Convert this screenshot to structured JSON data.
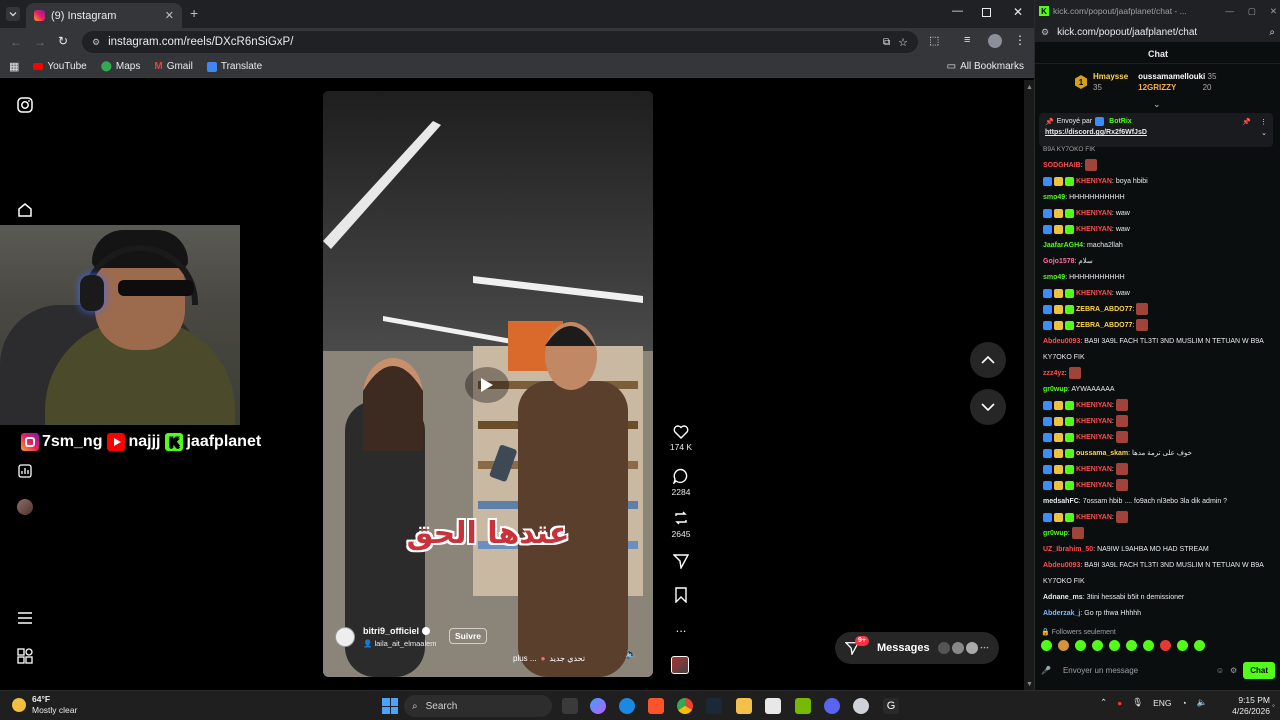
{
  "left_browser": {
    "tab_title": "(9) Instagram",
    "url": "instagram.com/reels/DXcR6nSiGxP/",
    "bookmarks": [
      "YouTube",
      "Maps",
      "Gmail",
      "Translate"
    ],
    "all_bookmarks": "All Bookmarks"
  },
  "instagram": {
    "notification_badge": "9+",
    "overlay_social": [
      "7sm_ng",
      "najjj",
      "jaafplanet"
    ],
    "reel": {
      "caption": "عندها الحق",
      "author": "bitri9_officiel",
      "follow_label": "Suivre",
      "collab": "laila_ait_elmaalem",
      "description": "تحدي جديد",
      "more": "plus ...",
      "likes": "174 K",
      "comments": "2284",
      "reposts": "2645",
      "more_icon": "..."
    },
    "messages_label": "Messages",
    "messages_badge": "9+"
  },
  "right_browser": {
    "title": "kick.com/popout/jaafplanet/chat - ...",
    "url": "kick.com/popout/jaafplanet/chat",
    "chat_header": "Chat",
    "top_gifters": [
      {
        "rank": "1",
        "name": "Hmaysse",
        "count": "35"
      },
      {
        "rank": "",
        "name": "oussamamellouki",
        "count": "35"
      },
      {
        "rank": "",
        "name": "12GRIZZY",
        "count": "20"
      }
    ],
    "pinned": {
      "by_label": "Envoyé par",
      "by_user": "BotRix",
      "link": "https://discord.gg/Rx2f6WfJsD",
      "partial_line": "B9A KY7OKO FIK"
    },
    "messages": [
      {
        "user": "SODGHAIB",
        "color": "#ff4d4d",
        "text": ""
      },
      {
        "user": "KHENIYAN",
        "color": "#ff4d4d",
        "text": "boya hbibi"
      },
      {
        "user": "smo49",
        "color": "#53fc18",
        "text": "HHHHHHHHHHH"
      },
      {
        "user": "KHENIYAN",
        "color": "#ff4d4d",
        "text": "waw"
      },
      {
        "user": "KHENIYAN",
        "color": "#ff4d4d",
        "text": "waw"
      },
      {
        "user": "JaafarAGH4",
        "color": "#53fc18",
        "text": "macha2llah"
      },
      {
        "user": "Gojo1578",
        "color": "#ff6b9d",
        "text": "سلام"
      },
      {
        "user": "smo49",
        "color": "#53fc18",
        "text": "HHHHHHHHHHH"
      },
      {
        "user": "KHENIYAN",
        "color": "#ff4d4d",
        "text": "waw"
      },
      {
        "user": "ZEBRA_ABDO77",
        "color": "#ffd54a",
        "text": ""
      },
      {
        "user": "ZEBRA_ABDO77",
        "color": "#ffd54a",
        "text": ""
      },
      {
        "user": "Abdeu0093",
        "color": "#ff4d4d",
        "text": "BA9I 3A9L FACH TL3TI 3ND MUSLIM N TETUAN W B9A KY7OKO FIK"
      },
      {
        "user": "zzz4yz",
        "color": "#ff4d4d",
        "text": ""
      },
      {
        "user": "gr0wup",
        "color": "#53fc18",
        "text": "AYWAAAAAA"
      },
      {
        "user": "KHENIYAN",
        "color": "#ff4d4d",
        "text": ""
      },
      {
        "user": "KHENIYAN",
        "color": "#ff4d4d",
        "text": ""
      },
      {
        "user": "KHENIYAN",
        "color": "#ff4d4d",
        "text": ""
      },
      {
        "user": "oussama_skam",
        "color": "#ffd54a",
        "text": "خوف على ترمة مدها"
      },
      {
        "user": "KHENIYAN",
        "color": "#ff4d4d",
        "text": ""
      },
      {
        "user": "KHENIYAN",
        "color": "#ff4d4d",
        "text": ""
      },
      {
        "user": "medsahFC",
        "color": "#e8eaed",
        "text": "7ossam hbib .... fo9ach nl3ebo 3la dik admin ?"
      },
      {
        "user": "KHENIYAN",
        "color": "#ff4d4d",
        "text": ""
      },
      {
        "user": "gr0wup",
        "color": "#53fc18",
        "text": ""
      },
      {
        "user": "UZ_Ibrahim_50",
        "color": "#ff4d4d",
        "text": "NA9IW L9AHBA MO HAD STREAM"
      },
      {
        "user": "Abdeu0093",
        "color": "#ff4d4d",
        "text": "BA9I 3A9L FACH TL3TI 3ND MUSLIM N TETUAN W B9A KY7OKO FIK"
      },
      {
        "user": "Adnane_ms",
        "color": "#e8eaed",
        "text": "3tini hessabi b5it n demissioner"
      },
      {
        "user": "Abderzak_j",
        "color": "#7ab8ff",
        "text": "Go rp thwa Hhhhh"
      }
    ],
    "followers_only": "Followers seulement",
    "input_placeholder": "Envoyer un message",
    "send_label": "Chat"
  },
  "taskbar": {
    "temperature": "64°F",
    "weather": "Mostly clear",
    "search": "Search",
    "lang": "ENG",
    "time": "9:15 PM",
    "date": "4/26/2026"
  }
}
